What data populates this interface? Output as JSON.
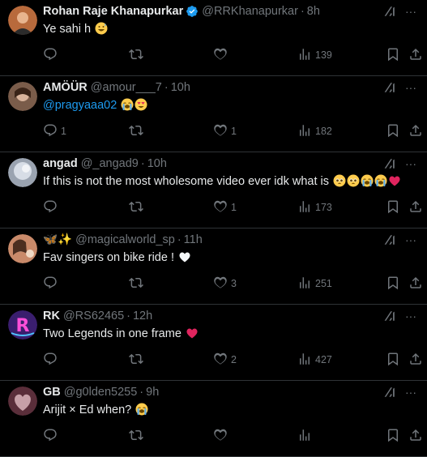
{
  "tweets": [
    {
      "name": "Rohan Raje Khanapurkar",
      "verified": true,
      "handle": "@RRKhanapurkar",
      "time": "8h",
      "text": "Ye sahi h",
      "emojis": [
        "grinning-sweat"
      ],
      "mention": "",
      "replies": "",
      "retweets": "",
      "likes": "",
      "views": "139",
      "avatar_color": "#b86a3c"
    },
    {
      "name": "AMÖÜR",
      "verified": false,
      "handle": "@amour___7",
      "time": "10h",
      "text": "",
      "emojis": [
        "crying-loud",
        "heart-eyes"
      ],
      "mention": "@pragyaaa02",
      "replies": "1",
      "retweets": "",
      "likes": "1",
      "views": "182",
      "avatar_color": "#7a5c4a"
    },
    {
      "name": "angad",
      "verified": false,
      "handle": "@_angad9",
      "time": "10h",
      "text": "If this is not the most wholesome video ever idk what is",
      "emojis": [
        "pleading",
        "pleading",
        "crying-loud",
        "crying-loud",
        "red-heart"
      ],
      "mention": "",
      "replies": "",
      "retweets": "",
      "likes": "1",
      "views": "173",
      "avatar_color": "#9aa3b0"
    },
    {
      "name": "🦋✨",
      "verified": false,
      "handle": "@magicalworld_sp",
      "time": "11h",
      "text": "Fav singers on bike ride !",
      "emojis": [
        "white-heart"
      ],
      "mention": "",
      "replies": "",
      "retweets": "",
      "likes": "3",
      "views": "251",
      "avatar_color": "#c98a6a"
    },
    {
      "name": "RK",
      "verified": false,
      "handle": "@RS62465",
      "time": "12h",
      "text": "Two Legends in one frame",
      "emojis": [
        "red-heart"
      ],
      "mention": "",
      "replies": "",
      "retweets": "",
      "likes": "2",
      "views": "427",
      "avatar_color": "#3a1e6e"
    },
    {
      "name": "GB",
      "verified": false,
      "handle": "@g0lden5255",
      "time": "9h",
      "text": "Arijit × Ed when?",
      "emojis": [
        "crying-loud"
      ],
      "mention": "",
      "replies": "",
      "retweets": "",
      "likes": "",
      "views": "",
      "avatar_color": "#5a2e3a"
    }
  ],
  "icons": {
    "reply": "reply-icon",
    "retweet": "retweet-icon",
    "like": "heart-icon",
    "views": "views-icon",
    "bookmark": "bookmark-icon",
    "share": "share-icon",
    "grok": "grok-icon",
    "more": "more-icon"
  },
  "colors": {
    "background": "#000000",
    "text": "#e7e9ea",
    "secondary": "#71767b",
    "link": "#1d9bf0",
    "border": "#2f3336",
    "verified": "#1d9bf0"
  }
}
